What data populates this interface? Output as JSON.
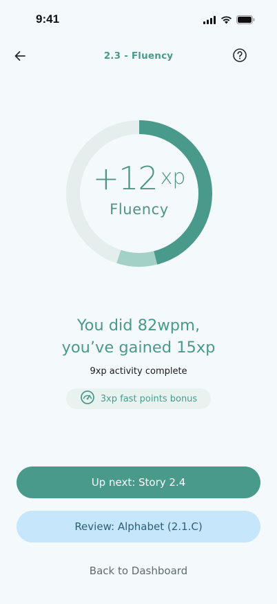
{
  "status_bar": {
    "time": "9:41"
  },
  "header": {
    "title": "2.3 - Fluency"
  },
  "ring": {
    "xp_value": "+12",
    "xp_unit": "xp",
    "label": "Fluency",
    "progress_fraction": 0.46,
    "secondary_fraction": 0.09
  },
  "result": {
    "line1": "You did 82wpm,",
    "line2": "you’ve gained 15xp",
    "activity": "9xp activity complete",
    "bonus": "3xp fast points bonus"
  },
  "actions": {
    "primary": "Up next: Story 2.4",
    "secondary": "Review: Alphabet (2.1.C)",
    "tertiary": "Back to Dashboard"
  },
  "colors": {
    "accent": "#4a9a8c",
    "ring_track": "#e4efed",
    "ring_secondary": "#a4d1c7",
    "secondary_button": "#c6e6fb"
  },
  "icons": [
    "back-arrow-icon",
    "help-icon",
    "speedometer-icon",
    "signal-icon",
    "wifi-icon",
    "battery-icon"
  ]
}
